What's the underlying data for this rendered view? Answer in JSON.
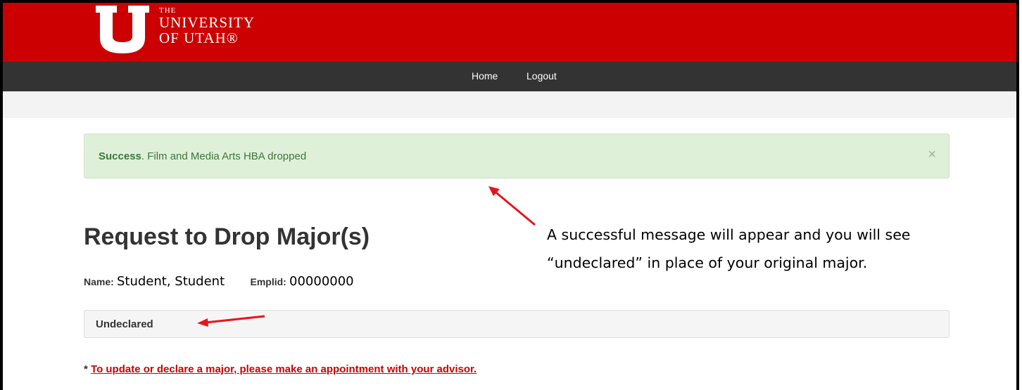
{
  "header": {
    "logo_the": "THE",
    "logo_line1": "UNIVERSITY",
    "logo_line2": "OF UTAH®",
    "brand_color": "#cc0000"
  },
  "nav": {
    "home": "Home",
    "logout": "Logout"
  },
  "alert": {
    "strong": "Success",
    "message": ". Film and Media Arts HBA dropped",
    "close": "×"
  },
  "page": {
    "title": "Request to Drop Major(s)"
  },
  "student": {
    "name_label": "Name",
    "name_value": "Student, Student",
    "emplid_label": "Emplid",
    "emplid_value": "00000000"
  },
  "major": {
    "value": "Undeclared"
  },
  "footnote": {
    "star": "* ",
    "link": "To update or declare a major, please make an appointment with your advisor."
  },
  "callout": {
    "text": "A successful message will appear and you will see “undeclared” in place of your original major."
  },
  "annotation_color": "#e8141b"
}
